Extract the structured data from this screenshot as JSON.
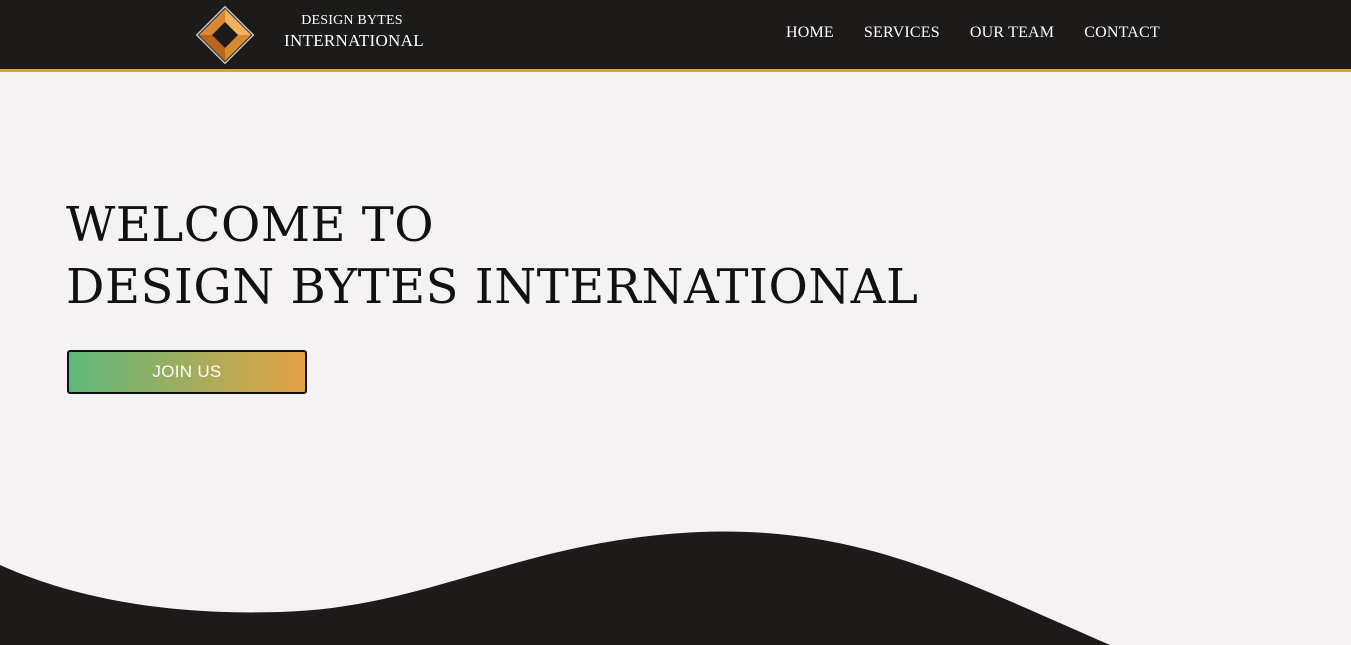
{
  "header": {
    "logo": {
      "icon": "diamond-logo-icon",
      "line1": "DESIGN BYTES",
      "line2": "INTERNATIONAL"
    },
    "nav": [
      {
        "label": "HOME"
      },
      {
        "label": "SERVICES"
      },
      {
        "label": "OUR TEAM"
      },
      {
        "label": "CONTACT"
      }
    ]
  },
  "hero": {
    "title_line1": "WELCOME TO",
    "title_line2": "DESIGN BYTES INTERNATIONAL",
    "cta_label": "JOIN US"
  },
  "colors": {
    "header_bg": "#1c1b1a",
    "accent": "#e0a044",
    "page_bg": "#f4f2f3",
    "gradient_start": "#5db879",
    "gradient_end": "#e3a244"
  }
}
